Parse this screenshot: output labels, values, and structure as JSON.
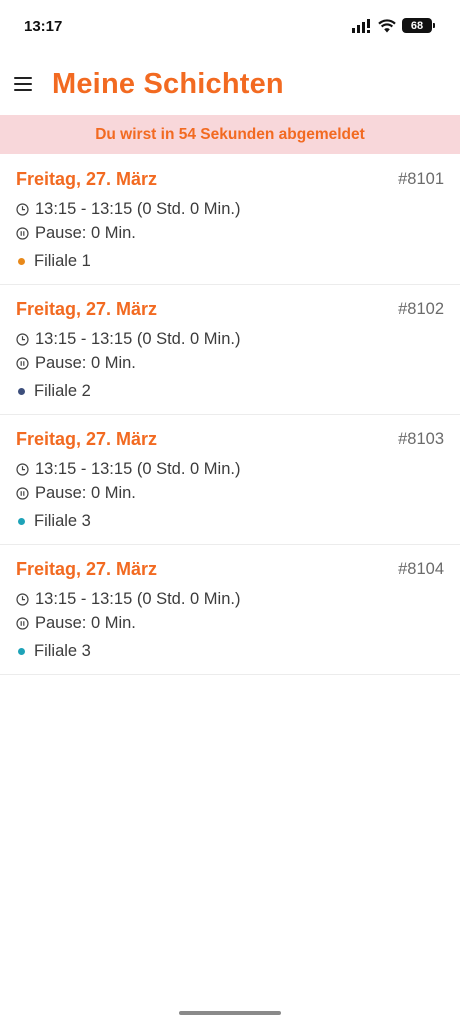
{
  "status_bar": {
    "time": "13:17",
    "battery": "68"
  },
  "header": {
    "title": "Meine Schichten"
  },
  "banner": {
    "text": "Du wirst in 54 Sekunden abgemeldet"
  },
  "colors": {
    "accent": "#f26a21",
    "banner_bg": "#f8d7da"
  },
  "shifts": [
    {
      "date": "Freitag, 27. März",
      "id": "#8101",
      "time": "13:15 - 13:15 (0 Std. 0 Min.)",
      "pause": "Pause: 0 Min.",
      "branch": "Filiale 1",
      "branch_color": "#e8891a"
    },
    {
      "date": "Freitag, 27. März",
      "id": "#8102",
      "time": "13:15 - 13:15 (0 Std. 0 Min.)",
      "pause": "Pause: 0 Min.",
      "branch": "Filiale 2",
      "branch_color": "#3d4f7c"
    },
    {
      "date": "Freitag, 27. März",
      "id": "#8103",
      "time": "13:15 - 13:15 (0 Std. 0 Min.)",
      "pause": "Pause: 0 Min.",
      "branch": "Filiale 3",
      "branch_color": "#1ea3b8"
    },
    {
      "date": "Freitag, 27. März",
      "id": "#8104",
      "time": "13:15 - 13:15 (0 Std. 0 Min.)",
      "pause": "Pause: 0 Min.",
      "branch": "Filiale 3",
      "branch_color": "#1ea3b8"
    }
  ]
}
